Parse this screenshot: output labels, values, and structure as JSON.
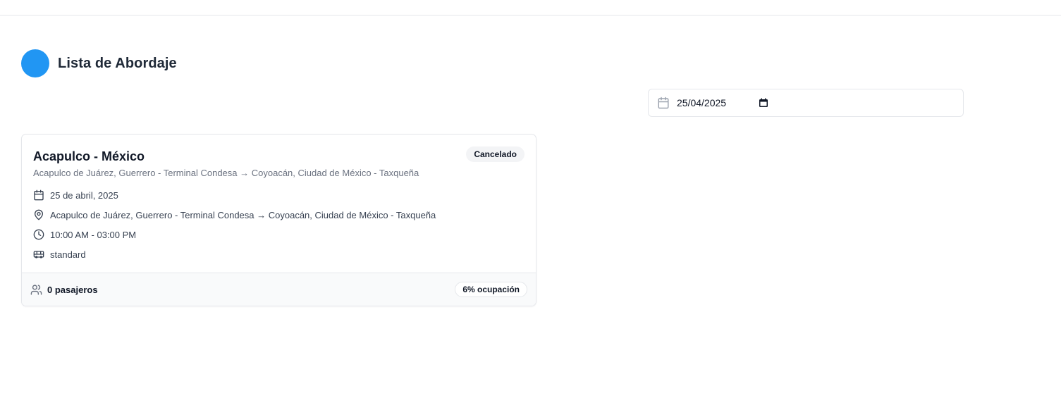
{
  "header": {
    "title": "Lista de Abordaje",
    "avatar_color": "#2196f3"
  },
  "filter": {
    "date_value": "25/04/2025",
    "calendar_icon": "calendar-icon",
    "picker_icon": "calendar-picker-icon"
  },
  "trip": {
    "title": "Acapulco - México",
    "subtitle": "Acapulco de Juárez, Guerrero - Terminal Condesa → Coyoacán, Ciudad de México - Taxqueña",
    "status": "Cancelado",
    "date": "25 de abril, 2025",
    "route": "Acapulco de Juárez, Guerrero - Terminal Condesa → Coyoacán, Ciudad de México - Taxqueña",
    "time": "10:00 AM - 03:00 PM",
    "bus_type": "standard",
    "passengers": "0 pasajeros",
    "occupancy": "6% ocupación"
  },
  "colors": {
    "accent": "#2196f3",
    "border": "#e5e7eb",
    "muted_text": "#6b7280",
    "footer_bg": "#f9fafb",
    "badge_bg": "#f3f4f6"
  }
}
